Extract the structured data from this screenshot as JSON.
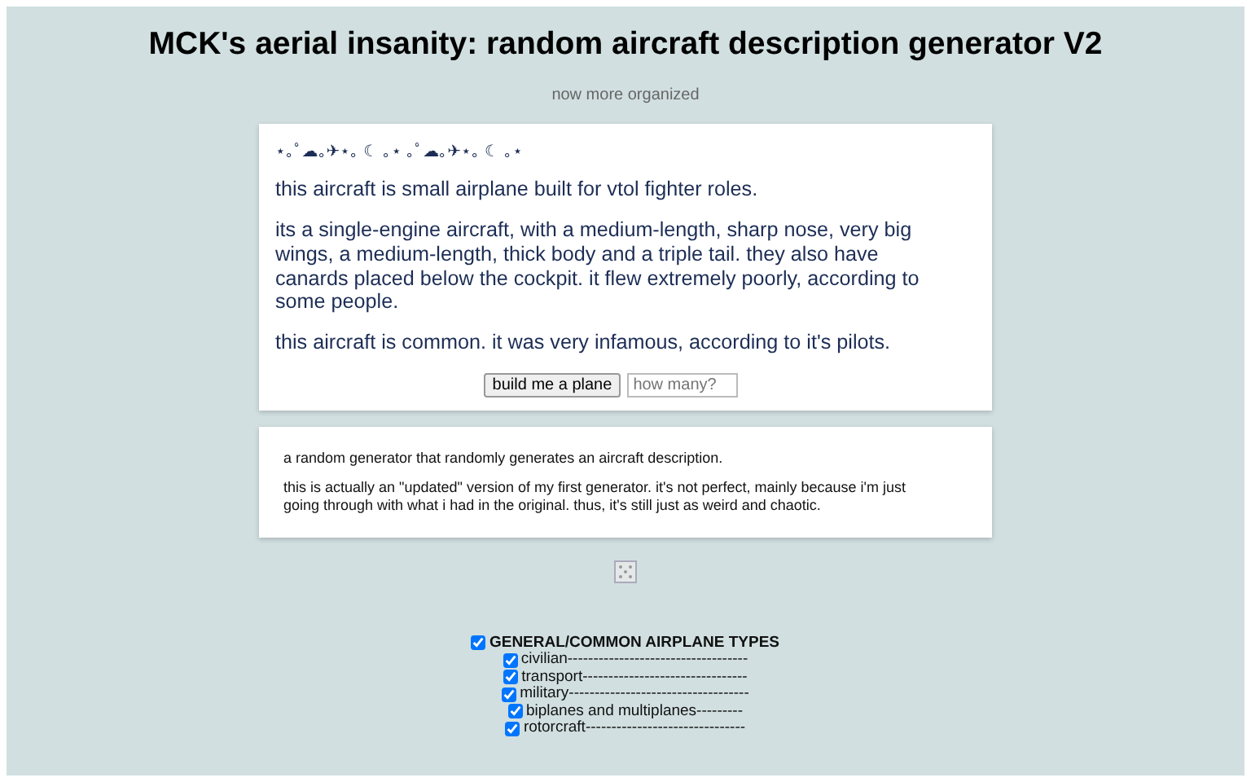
{
  "title": "MCK's aerial insanity: random aircraft description generator V2",
  "subtitle": "now more organized",
  "result": {
    "decoration": "⋆｡ﾟ☁｡✈⋆｡ ☾ ｡⋆ ｡ﾟ☁｡✈⋆｡ ☾ ｡⋆",
    "paragraphs": [
      "this aircraft is small airplane built for vtol fighter roles.",
      "its a single-engine aircraft, with a medium-length, sharp nose, very big wings, a medium-length, thick body and a triple tail. they also have canards placed below the cockpit. it flew extremely poorly, according to some people.",
      "this aircraft is common. it was very infamous, according to it's pilots."
    ],
    "button": "build me a plane",
    "count_field": {
      "placeholder": "how many?"
    }
  },
  "about": [
    "a random generator that randomly generates an aircraft description.",
    "this is actually an \"updated\" version of my first generator. it's not perfect, mainly because i'm just going through with what i had in the original. thus, it's still just as weird and chaotic."
  ],
  "categories": [
    {
      "label": "GENERAL/COMMON AIRPLANE TYPES",
      "checked": true,
      "children": [
        {
          "label": "civilian-----------------------------------",
          "checked": true
        },
        {
          "label": "transport--------------------------------",
          "checked": true
        },
        {
          "label": "military-----------------------------------",
          "checked": true
        },
        {
          "label": "biplanes and multiplanes---------",
          "checked": true
        },
        {
          "label": "rotorcraft-------------------------------",
          "checked": true
        }
      ]
    }
  ]
}
